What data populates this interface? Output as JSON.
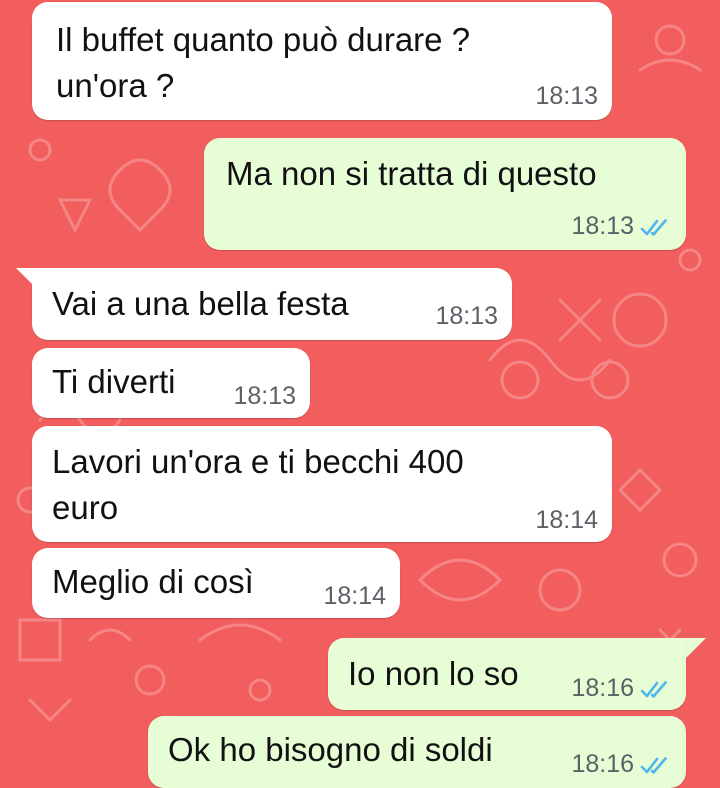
{
  "messages": [
    {
      "text_lines": [
        "Il buffet quanto può durare ?",
        "un'ora ?"
      ],
      "time": "18:13"
    },
    {
      "text": "Ma non si tratta di questo",
      "time": "18:13"
    },
    {
      "text": "Vai a una bella festa",
      "time": "18:13"
    },
    {
      "text": "Ti diverti",
      "time": "18:13"
    },
    {
      "text_lines": [
        "Lavori un'ora e ti becchi 400",
        "euro"
      ],
      "time": "18:14"
    },
    {
      "text": "Meglio di così",
      "time": "18:14"
    },
    {
      "text": "Io non lo so",
      "time": "18:16"
    },
    {
      "text": "Ok ho bisogno di soldi",
      "time": "18:16"
    }
  ],
  "colors": {
    "wallpaper": "#f25d5d",
    "incoming_bubble": "#ffffff",
    "outgoing_bubble": "#e7fdd6",
    "read_ticks": "#4fb6ec"
  },
  "icons": {
    "read_receipt": "double-check-icon"
  }
}
